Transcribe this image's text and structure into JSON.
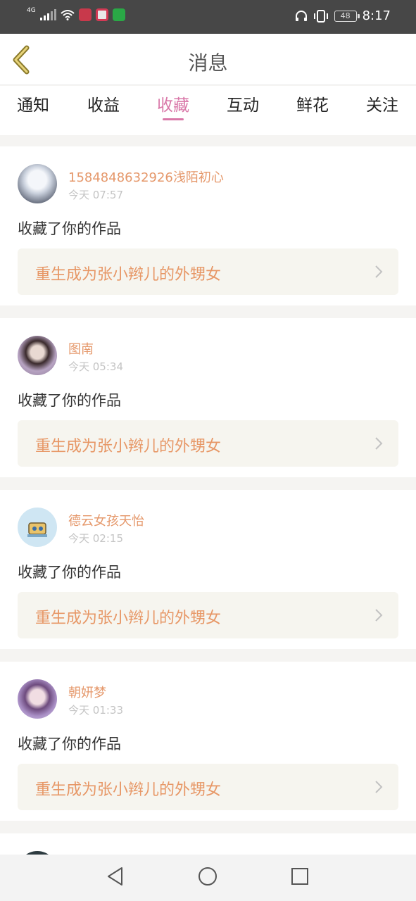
{
  "status_bar": {
    "network": "4G",
    "battery": "48",
    "time": "8:17"
  },
  "header": {
    "title": "消息",
    "back_icon": "chevron-left-icon"
  },
  "tabs": [
    {
      "label": "通知",
      "active": false
    },
    {
      "label": "收益",
      "active": false
    },
    {
      "label": "收藏",
      "active": true
    },
    {
      "label": "互动",
      "active": false
    },
    {
      "label": "鲜花",
      "active": false
    },
    {
      "label": "关注",
      "active": false
    }
  ],
  "messages": [
    {
      "user": "1584848632926浅陌初心",
      "time": "今天 07:57",
      "action": "收藏了你的作品",
      "work": "重生成为张小辫儿的外甥女"
    },
    {
      "user": "图南",
      "time": "今天 05:34",
      "action": "收藏了你的作品",
      "work": "重生成为张小辫儿的外甥女"
    },
    {
      "user": "德云女孩天怡",
      "time": "今天 02:15",
      "action": "收藏了你的作品",
      "work": "重生成为张小辫儿的外甥女"
    },
    {
      "user": "朝妍梦",
      "time": "今天 01:33",
      "action": "收藏了你的作品",
      "work": "重生成为张小辫儿的外甥女"
    }
  ],
  "colors": {
    "accent": "#d977a8",
    "username": "#e5986b",
    "work_title": "#e79766",
    "status_bar": "#474747"
  }
}
